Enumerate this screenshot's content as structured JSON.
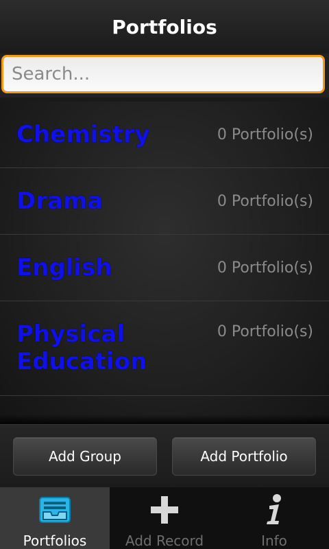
{
  "header": {
    "title": "Portfolios"
  },
  "search": {
    "placeholder": "Search..."
  },
  "groups": [
    {
      "name": "Chemistry",
      "count": "0 Portfolio(s)"
    },
    {
      "name": "Drama",
      "count": "0 Portfolio(s)"
    },
    {
      "name": "English",
      "count": "0 Portfolio(s)"
    },
    {
      "name": "Physical Education",
      "count": "0 Portfolio(s)"
    }
  ],
  "actions": {
    "add_group": "Add Group",
    "add_portfolio": "Add Portfolio"
  },
  "tabs": [
    {
      "label": "Portfolios",
      "icon": "inbox-tray-icon",
      "active": true
    },
    {
      "label": "Add Record",
      "icon": "plus-icon",
      "active": false
    },
    {
      "label": "Info",
      "icon": "info-icon",
      "active": false
    }
  ],
  "colors": {
    "accent": "#f39a1a",
    "group_name": "#1010e8",
    "tab_icon_active": "#29b6e6"
  }
}
